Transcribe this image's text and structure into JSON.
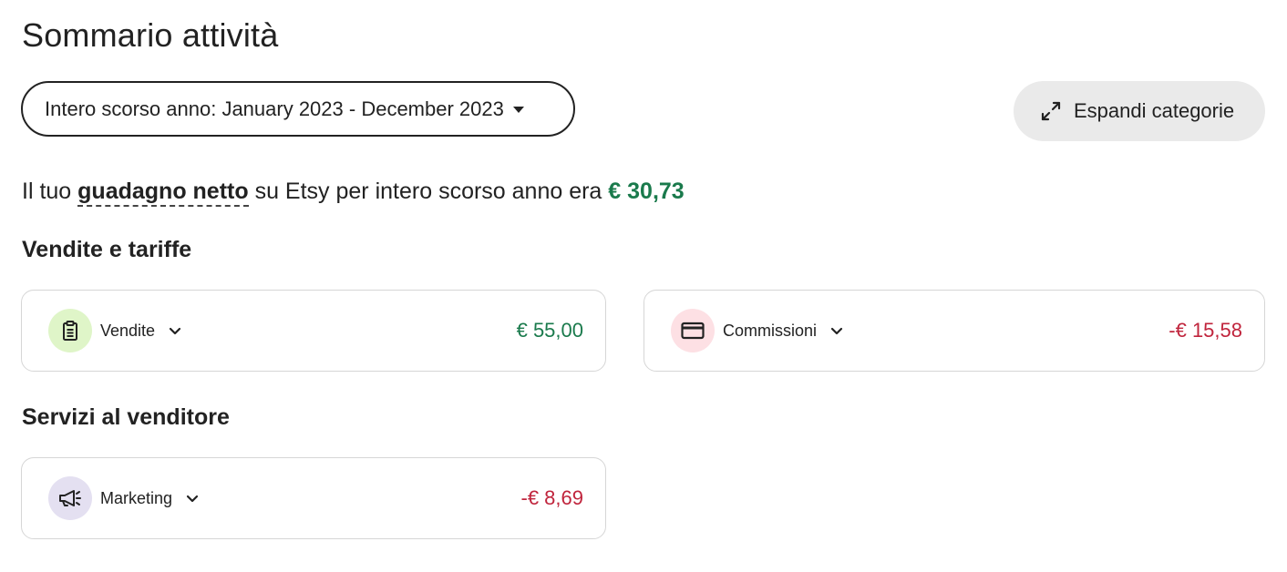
{
  "header": {
    "title": "Sommario attività"
  },
  "period_select": {
    "label": "Intero scorso anno: January 2023 - December 2023"
  },
  "expand_button": {
    "label": "Espandi categorie",
    "icon": "expand-arrows-icon"
  },
  "summary": {
    "prefix": "Il tuo ",
    "term": "guadagno netto",
    "middle": " su Etsy per intero scorso anno era ",
    "amount": "€ 30,73"
  },
  "sections": {
    "sales_fees": {
      "title": "Vendite e tariffe",
      "cards": [
        {
          "label": "Vendite",
          "value": "€ 55,00",
          "icon": "clipboard-icon",
          "badge_color": "#dff5c8",
          "value_color": "#1a7a4c"
        },
        {
          "label": "Commissioni",
          "value": "-€ 15,58",
          "icon": "credit-card-icon",
          "badge_color": "#fde0e4",
          "value_color": "#c0243c"
        }
      ]
    },
    "seller_services": {
      "title": "Servizi al venditore",
      "cards": [
        {
          "label": "Marketing",
          "value": "-€ 8,69",
          "icon": "megaphone-icon",
          "badge_color": "#e4e0f1",
          "value_color": "#c0243c"
        }
      ]
    }
  }
}
